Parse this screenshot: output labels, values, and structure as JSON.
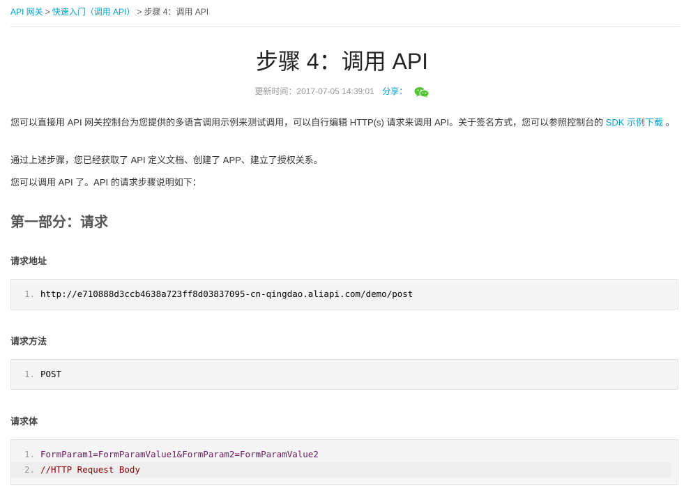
{
  "breadcrumb": {
    "items": [
      "API 网关",
      "快速入门（调用 API）",
      "步骤 4：调用 API"
    ],
    "separator": ">"
  },
  "page": {
    "title": "步骤 4：调用 API",
    "updated": "更新时间：2017-07-05 14:39:01",
    "share_label": "分享："
  },
  "intro": {
    "p1_text": "您可以直接用 API 网关控制台为您提供的多语言调用示例来测试调用，可以自行编辑 HTTP(s) 请求来调用 API。关于签名方式，您可以参照控制台的 ",
    "p1_link": "SDK 示例下载",
    "p1_end": " 。",
    "p2": "通过上述步骤，您已经获取了 API 定义文档、创建了 APP、建立了授权关系。",
    "p3": "您可以调用 API 了。API 的请求步骤说明如下："
  },
  "section": {
    "title": "第一部分：请求",
    "address": {
      "heading": "请求地址",
      "lines": [
        "http://e710888d3ccb4638a723ff8d03837095-cn-qingdao.aliapi.com/demo/post"
      ]
    },
    "method": {
      "heading": "请求方法",
      "lines": [
        "POST"
      ]
    },
    "body": {
      "heading": "请求体",
      "lines": [
        "FormParam1=FormParamValue1&FormParam2=FormParamValue2",
        "//HTTP Request Body"
      ]
    },
    "line_numbers": [
      "1.",
      "2."
    ]
  },
  "colors": {
    "link": "#00a2ca",
    "wechat": "#51c332"
  }
}
